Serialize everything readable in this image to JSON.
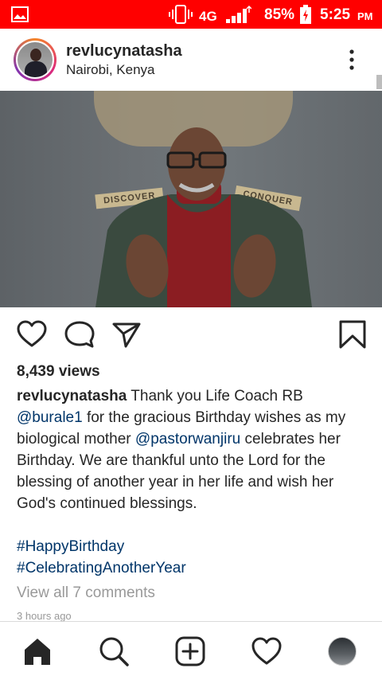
{
  "status_bar": {
    "network": "4G",
    "battery": "85%",
    "time": "5:25",
    "ampm": "PM",
    "bg_color": "#ff0000"
  },
  "post": {
    "username": "revlucynatasha",
    "location": "Nairobi, Kenya",
    "video_ribbon_left": "DISCOVER",
    "video_ribbon_right": "CONQUER",
    "views": "8,439 views",
    "caption": {
      "username": "revlucynatasha",
      "p1": " Thank you Life Coach RB ",
      "mention1": "@burale1",
      "p2": " for the gracious Birthday wishes as my biological mother ",
      "mention2": "@pastorwanjiru",
      "p3": " celebrates her Birthday. We are thankful unto the Lord for the blessing of another year in her life and wish her God's continued blessings.",
      "hashtags": [
        "#HappyBirthday",
        "#CelebratingAnotherYear"
      ]
    },
    "view_comments": "View all 7 comments",
    "time_ago": "3 hours ago"
  },
  "icons": {
    "like": "heart-icon",
    "comment": "comment-icon",
    "share": "send-icon",
    "save": "bookmark-icon",
    "more": "more-vertical-icon"
  },
  "nav": [
    "home",
    "search",
    "add",
    "activity",
    "profile"
  ],
  "colors": {
    "link": "#003569",
    "muted": "#999999",
    "text": "#262626"
  }
}
